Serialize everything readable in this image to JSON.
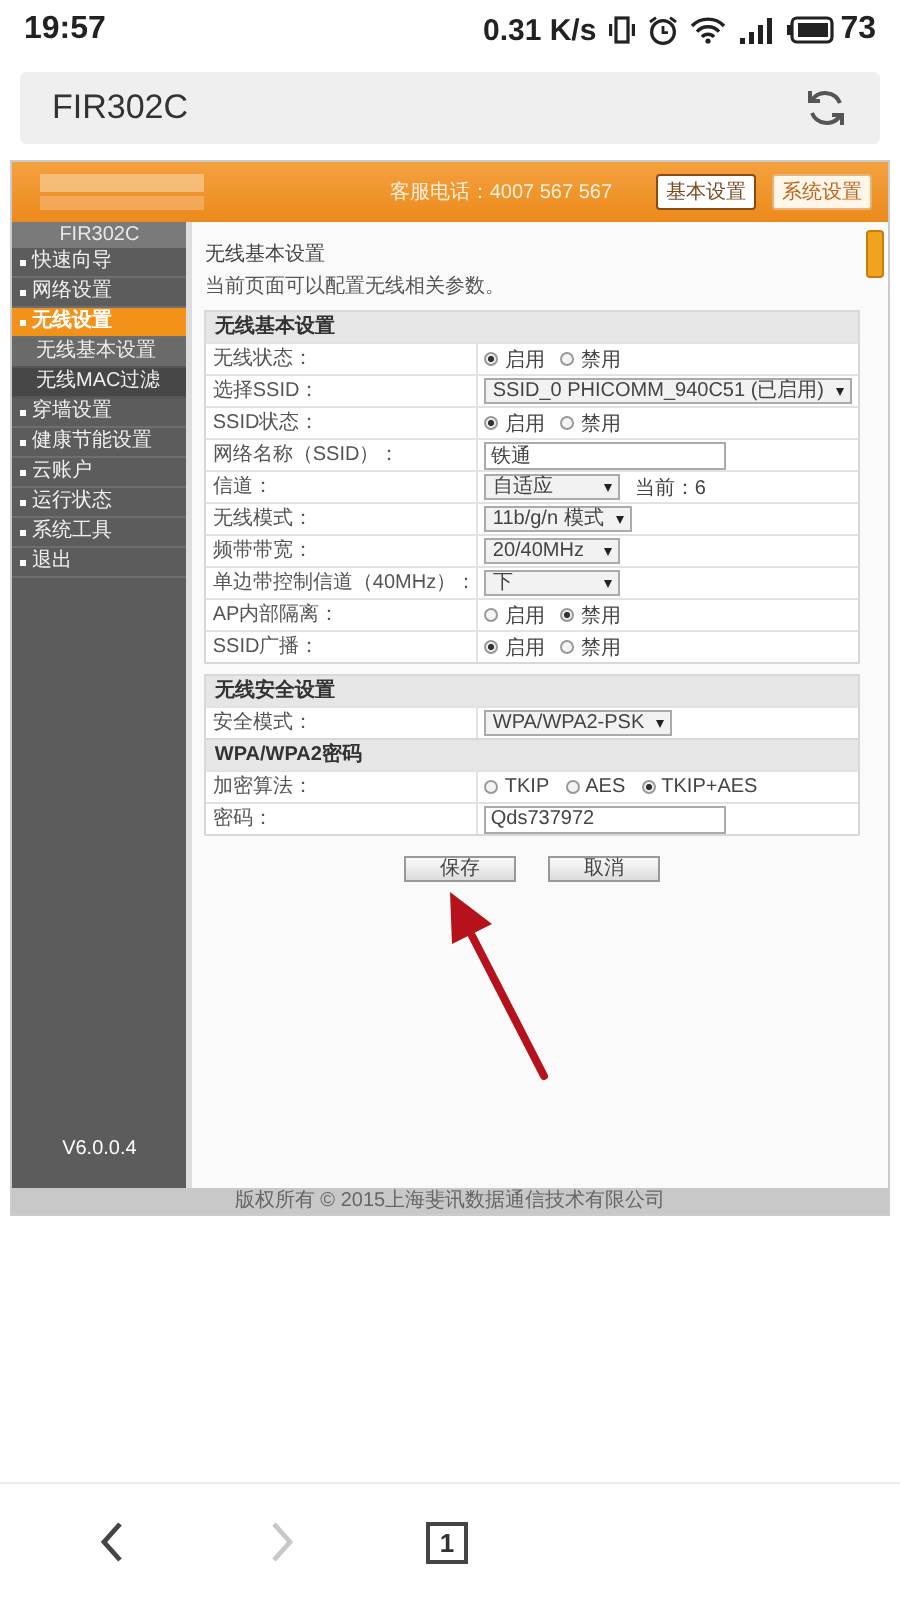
{
  "status_bar": {
    "time": "19:57",
    "speed": "0.31 K/s",
    "battery": "73"
  },
  "address_bar": {
    "title": "FIR302C"
  },
  "router": {
    "header": {
      "phone": "客服电话：4007 567 567",
      "buttons": [
        {
          "label": "基本设置",
          "selected": true
        },
        {
          "label": "系统设置",
          "selected": false
        }
      ]
    },
    "sidebar": {
      "title": "FIR302C",
      "version": "V6.0.0.4",
      "items": [
        {
          "label": "快速向导",
          "selected": false
        },
        {
          "label": "网络设置",
          "selected": false
        },
        {
          "label": "无线设置",
          "selected": true,
          "children": [
            {
              "label": "无线基本设置",
              "selected": true
            },
            {
              "label": "无线MAC过滤",
              "selected": false
            }
          ]
        },
        {
          "label": "穿墙设置",
          "selected": false
        },
        {
          "label": "健康节能设置",
          "selected": false
        },
        {
          "label": "云账户",
          "selected": false
        },
        {
          "label": "运行状态",
          "selected": false
        },
        {
          "label": "系统工具",
          "selected": false
        },
        {
          "label": "退出",
          "selected": false
        }
      ]
    },
    "content": {
      "title": "无线基本设置",
      "description": "当前页面可以配置无线相关参数。",
      "sections": [
        {
          "title": "无线基本设置",
          "kind": "group",
          "rows": [
            {
              "label": "无线状态：",
              "kind": "radio",
              "options": [
                {
                  "label": "启用",
                  "selected": true
                },
                {
                  "label": "禁用",
                  "selected": false
                }
              ]
            },
            {
              "label": "选择SSID：",
              "kind": "select",
              "value": "SSID_0 PHICOMM_940C51 (已启用)"
            },
            {
              "label": "SSID状态：",
              "kind": "radio",
              "options": [
                {
                  "label": "启用",
                  "selected": true
                },
                {
                  "label": "禁用",
                  "selected": false
                }
              ]
            },
            {
              "label": "网络名称（SSID）：",
              "kind": "text",
              "value": "铁通"
            },
            {
              "label": "信道：",
              "kind": "select",
              "value": "自适应",
              "note": "当前：6"
            },
            {
              "label": "无线模式：",
              "kind": "select",
              "value": "11b/g/n 模式"
            },
            {
              "label": "频带带宽：",
              "kind": "select",
              "value": "20/40MHz"
            },
            {
              "label": "单边带控制信道（40MHz）：",
              "kind": "select",
              "value": "下"
            },
            {
              "label": "AP内部隔离：",
              "kind": "radio",
              "options": [
                {
                  "label": "启用",
                  "selected": false
                },
                {
                  "label": "禁用",
                  "selected": true
                }
              ]
            },
            {
              "label": "SSID广播：",
              "kind": "radio",
              "options": [
                {
                  "label": "启用",
                  "selected": true
                },
                {
                  "label": "禁用",
                  "selected": false
                }
              ]
            }
          ]
        },
        {
          "title": "无线安全设置",
          "kind": "group",
          "rows": [
            {
              "label": "安全模式：",
              "kind": "select",
              "value": "WPA/WPA2-PSK"
            }
          ]
        },
        {
          "title": "WPA/WPA2密码",
          "kind": "subgroup",
          "rows": [
            {
              "label": "加密算法：",
              "kind": "radio",
              "options": [
                {
                  "label": "TKIP",
                  "selected": false
                },
                {
                  "label": "AES",
                  "selected": false
                },
                {
                  "label": "TKIP+AES",
                  "selected": true
                }
              ]
            },
            {
              "label": "密码：",
              "kind": "text",
              "value": "Qds737972"
            }
          ]
        }
      ],
      "buttons": [
        "保存",
        "取消"
      ]
    },
    "footer": "版权所有 © 2015上海斐讯数据通信技术有限公司"
  },
  "bottom_nav": {
    "buttons": [
      {
        "kind": "back",
        "disabled": false
      },
      {
        "kind": "forward",
        "disabled": true
      }
    ],
    "tab_count": "1"
  }
}
